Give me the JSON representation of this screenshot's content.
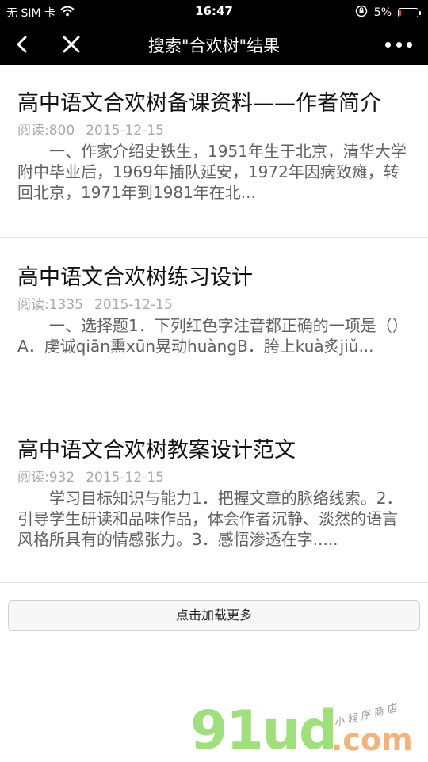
{
  "status_bar": {
    "carrier": "无 SIM 卡",
    "time": "16:47",
    "battery_percent_text": "5%",
    "battery_level": 0.05,
    "battery_color": "#e53935",
    "icons": [
      "wifi-icon",
      "orientation-lock-icon",
      "battery-icon"
    ]
  },
  "nav": {
    "title": "搜索\"合欢树\"结果",
    "back_icon": "chevron-left-icon",
    "close_icon": "close-icon",
    "more_icon": "more-dots-icon"
  },
  "results": [
    {
      "title": "高中语文合欢树备课资料——作者简介",
      "reads": "阅读:800",
      "date": "2015-12-15",
      "excerpt": "一、作家介绍史铁生，1951年生于北京，清华大学附中毕业后，1969年插队延安，1972年因病致瘫，转回北京，1971年到1981年在北..."
    },
    {
      "title": "高中语文合欢树练习设计",
      "reads": "阅读:1335",
      "date": "2015-12-15",
      "excerpt": "一、选择题1．下列红色字注音都正确的一项是（）A．虔诚qiān熏xūn晃动huàngB．胯上kuà炙jiǔ..."
    },
    {
      "title": "高中语文合欢树教案设计范文",
      "reads": "阅读:932",
      "date": "2015-12-15",
      "excerpt": "学习目标知识与能力1．把握文章的脉络线索。2．引导学生研读和品味作品，体会作者沉静、淡然的语言风格所具有的情感张力。3．感悟渗透在字....."
    }
  ],
  "load_more_label": "点击加载更多",
  "watermark": {
    "logo": "91ud",
    "domain": ".com",
    "tagline": "小程序商店"
  }
}
